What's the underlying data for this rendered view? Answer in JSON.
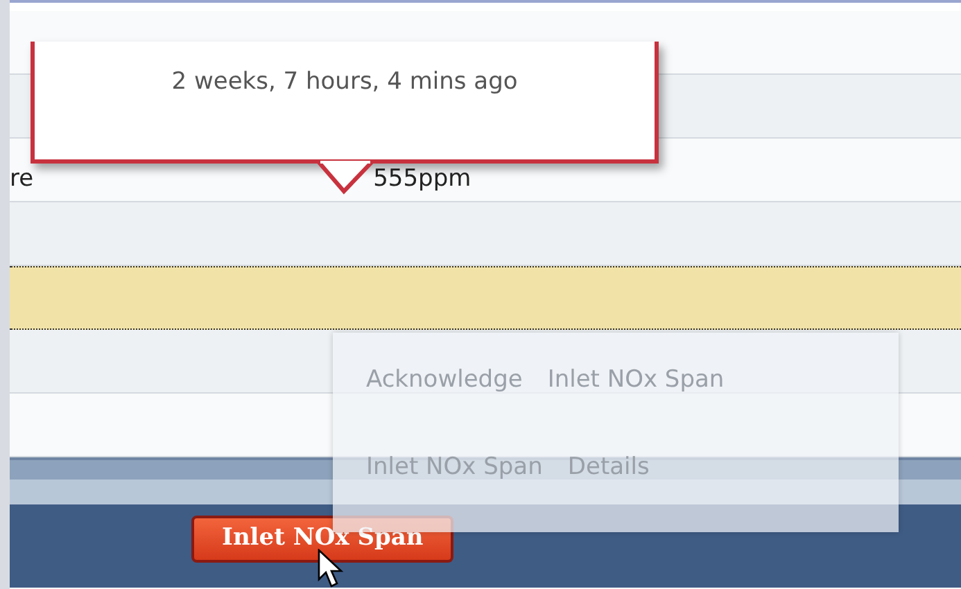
{
  "tooltip": {
    "text": "2 weeks, 7 hours, 4 mins ago"
  },
  "rows": [
    {
      "kind": "plain",
      "highlighted": false,
      "fragments": []
    },
    {
      "kind": "plain",
      "highlighted": false,
      "fragments": []
    },
    {
      "kind": "text",
      "highlighted": false,
      "fragments": [
        "re",
        "555ppm"
      ]
    },
    {
      "kind": "plain",
      "highlighted": false,
      "fragments": []
    },
    {
      "kind": "plain",
      "highlighted": true,
      "fragments": []
    },
    {
      "kind": "plain",
      "highlighted": false,
      "fragments": []
    },
    {
      "kind": "plain",
      "highlighted": false,
      "fragments": []
    }
  ],
  "context_menu": {
    "items": [
      {
        "label": "Acknowledge",
        "detail": "Inlet NOx Span"
      },
      {
        "label": "Inlet NOx Span",
        "detail": "Details"
      }
    ]
  },
  "taskbar": {
    "alarm_button": "Inlet NOx Span"
  }
}
